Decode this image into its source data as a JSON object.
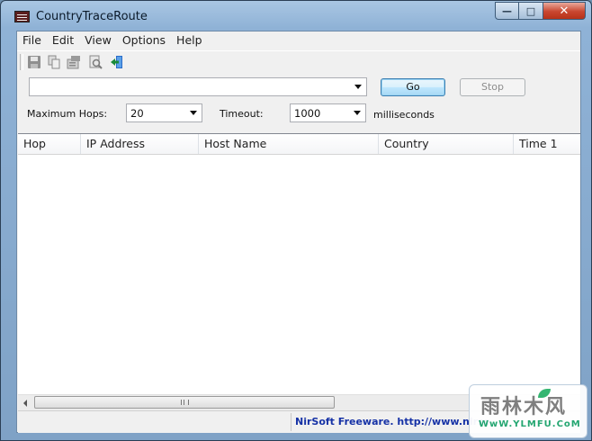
{
  "window": {
    "title": "CountryTraceRoute"
  },
  "caption": {
    "minimize": "—",
    "maximize": "□",
    "close": "✕"
  },
  "menu": [
    "File",
    "Edit",
    "View",
    "Options",
    "Help"
  ],
  "toolbar": {
    "icons": [
      "save-icon",
      "copy-icon",
      "properties-icon",
      "find-icon",
      "exit-icon"
    ]
  },
  "form": {
    "address_value": "",
    "go_label": "Go",
    "stop_label": "Stop",
    "max_hops_label": "Maximum Hops:",
    "max_hops_value": "20",
    "timeout_label": "Timeout:",
    "timeout_value": "1000",
    "timeout_unit": "milliseconds"
  },
  "table": {
    "columns": [
      "Hop",
      "IP Address",
      "Host Name",
      "Country",
      "Time 1"
    ],
    "rows": []
  },
  "status": {
    "link_text": "NirSoft Freeware.  http://www.nirso"
  },
  "watermark": {
    "text": "雨林木风",
    "url": "WwW.YLMFU.CoM"
  },
  "colors": {
    "status_link": "#1632a6",
    "close_button": "#c9462f"
  }
}
